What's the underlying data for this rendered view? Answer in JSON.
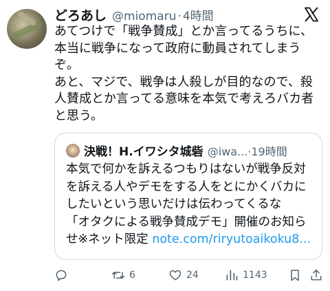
{
  "tweet": {
    "display_name": "どろあし",
    "handle": "@miomaru",
    "separator": "·",
    "time": "4時間",
    "lines": [
      "あてつけで「戦争賛成」とか言ってるうちに、",
      "本当に戦争になって政府に動員されてしまう",
      "ぞ。",
      "あと、マジで、戦争は人殺しが目的なので、殺",
      "人賛成とか言ってる意味を本気で考えろバカ者",
      "と思う。"
    ]
  },
  "quote": {
    "display_name": "決戦！H.イワシタ城砦",
    "handle": "@iwa...",
    "separator": "·",
    "time": "19時間",
    "lines": [
      "本気で何かを訴えるつもりはないが戦争反対",
      "を訴える人やデモをする人をとにかくバカに",
      "したいという思いだけは伝わってくるな",
      "「オタクによる戦争賛成デモ」開催のお知ら"
    ],
    "last_line_text": "せ※ネット限定 ",
    "link_text": "note.com/riryutoaikoku8..."
  },
  "actions": {
    "reply_count": "",
    "retweet_count": "6",
    "like_count": "24",
    "view_count": "1143"
  },
  "icons": {
    "logo": "x-logo-icon",
    "reply": "reply-icon",
    "retweet": "retweet-icon",
    "like": "heart-icon",
    "views": "views-icon",
    "bookmark": "bookmark-icon",
    "share": "share-icon"
  },
  "colors": {
    "text": "#0f1419",
    "secondary": "#536471",
    "link": "#1d9bf0",
    "border": "#cfd9de"
  }
}
